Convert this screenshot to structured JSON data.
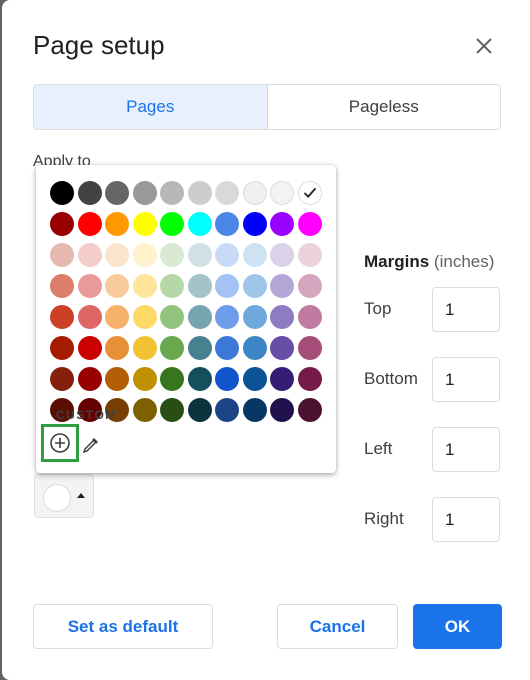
{
  "dialog": {
    "title": "Page setup",
    "tabs": [
      {
        "label": "Pages",
        "active": true
      },
      {
        "label": "Pageless",
        "active": false
      }
    ],
    "apply_to_label": "Apply to",
    "margins": {
      "heading": "Margins",
      "unit": "(inches)",
      "fields": [
        {
          "label": "Top",
          "value": "1"
        },
        {
          "label": "Bottom",
          "value": "1"
        },
        {
          "label": "Left",
          "value": "1"
        },
        {
          "label": "Right",
          "value": "1"
        }
      ]
    },
    "buttons": {
      "set_default": "Set as default",
      "cancel": "Cancel",
      "ok": "OK"
    }
  },
  "palette": {
    "selected": "#ffffff",
    "rows": [
      [
        "#000000",
        "#434343",
        "#666666",
        "#999999",
        "#b7b7b7",
        "#cccccc",
        "#d9d9d9",
        "#efefef",
        "#f3f3f3",
        "#ffffff"
      ],
      [
        "#980000",
        "#ff0000",
        "#ff9900",
        "#ffff00",
        "#00ff00",
        "#00ffff",
        "#4a86e8",
        "#0000ff",
        "#9900ff",
        "#ff00ff"
      ],
      [
        "#e6b8af",
        "#f4cccc",
        "#fce5cd",
        "#fff2cc",
        "#d9ead3",
        "#d0e0e3",
        "#c9daf8",
        "#cfe2f3",
        "#d9d2e9",
        "#ead1dc"
      ],
      [
        "#dd7e6b",
        "#ea9999",
        "#f9cb9c",
        "#ffe599",
        "#b6d7a8",
        "#a2c4c9",
        "#a4c2f4",
        "#9fc5e8",
        "#b4a7d6",
        "#d5a6bd"
      ],
      [
        "#cc4125",
        "#e06666",
        "#f6b26b",
        "#ffd966",
        "#93c47d",
        "#76a5af",
        "#6d9eeb",
        "#6fa8dc",
        "#8e7cc3",
        "#c27ba0"
      ],
      [
        "#a61c00",
        "#cc0000",
        "#e69138",
        "#f1c232",
        "#6aa84f",
        "#45818e",
        "#3c78d8",
        "#3d85c6",
        "#674ea7",
        "#a64d79"
      ],
      [
        "#85200c",
        "#990000",
        "#b45f06",
        "#bf9000",
        "#38761d",
        "#134f5c",
        "#1155cc",
        "#0b5394",
        "#351c75",
        "#741b47"
      ],
      [
        "#5b0f00",
        "#660000",
        "#783f04",
        "#7f6000",
        "#274e13",
        "#0c343d",
        "#1c4587",
        "#073763",
        "#20124d",
        "#4c1130"
      ]
    ],
    "custom_label": "CUSTOM",
    "icons": {
      "add": "add-circle-icon",
      "eyedropper": "eyedropper-icon"
    },
    "highlight_color": "#2e9e3f"
  }
}
